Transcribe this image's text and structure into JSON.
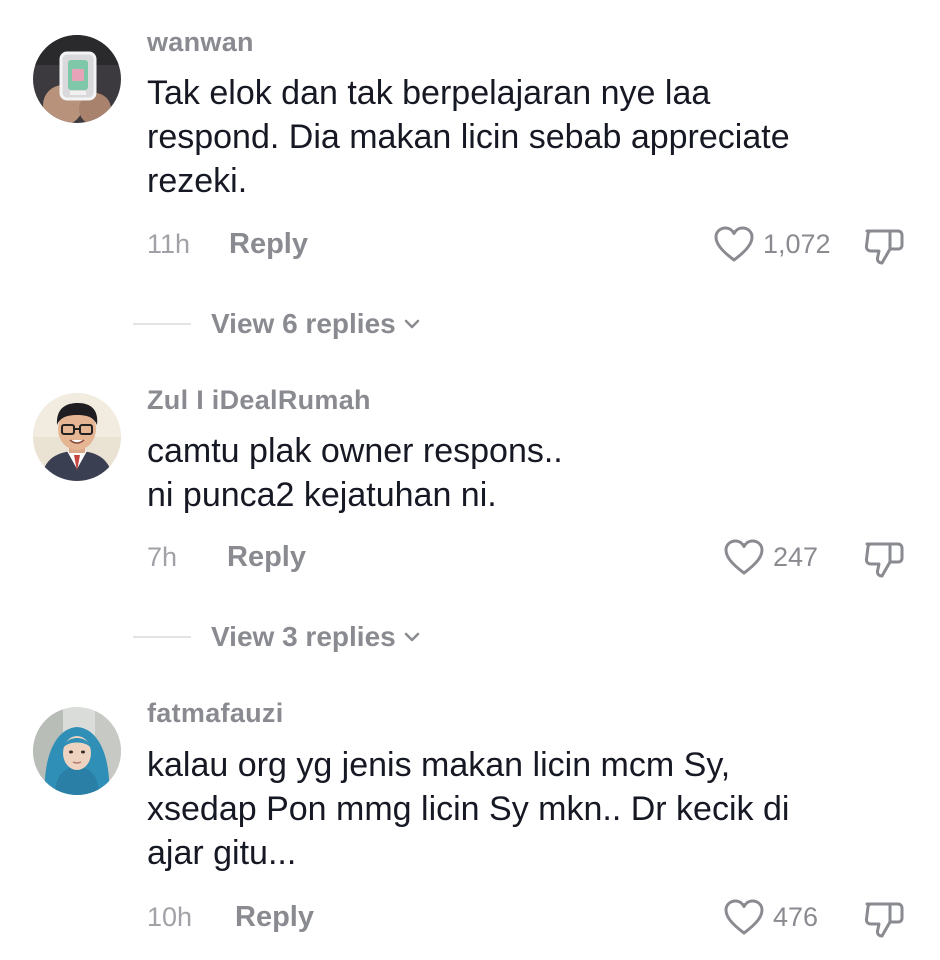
{
  "comments": [
    {
      "username": "wanwan",
      "lines": [
        "Tak elok dan tak berpelajaran nye laa",
        "respond. Dia makan licin sebab appreciate",
        "rezeki."
      ],
      "time": "11h",
      "reply_label": "Reply",
      "likes": "1,072",
      "view_replies": "View 6 replies"
    },
    {
      "username": "Zul I iDealRumah",
      "lines": [
        "camtu plak owner respons..",
        "ni punca2 kejatuhan ni."
      ],
      "time": "7h",
      "reply_label": "Reply",
      "likes": "247",
      "view_replies": "View 3 replies"
    },
    {
      "username": "fatmafauzi",
      "lines": [
        "kalau org yg jenis makan licin mcm Sy,",
        "xsedap Pon mmg licin Sy mkn.. Dr kecik di",
        "ajar gitu..."
      ],
      "time": "10h",
      "reply_label": "Reply",
      "likes": "476"
    }
  ],
  "icons": {
    "like": "heart-outline-icon",
    "dislike": "thumbs-down-outline-icon",
    "expand": "chevron-down-icon"
  },
  "colors": {
    "text": "#161823",
    "secondary": "#8a8b91",
    "muted": "#a1a2a7",
    "divider": "#e3e3e4"
  }
}
